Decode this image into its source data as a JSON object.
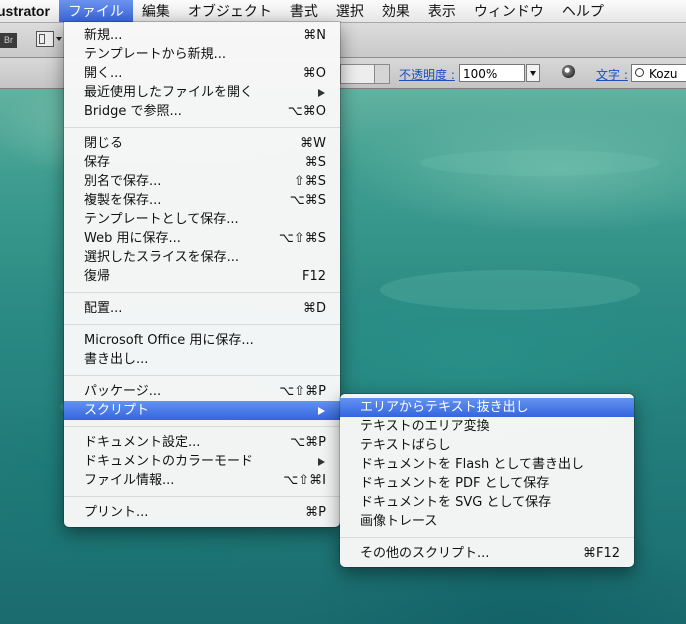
{
  "menubar": {
    "app": "ustrator",
    "items": [
      "ファイル",
      "編集",
      "オブジェクト",
      "書式",
      "選択",
      "効果",
      "表示",
      "ウィンドウ",
      "ヘルプ"
    ]
  },
  "toolbar": {
    "bridge_badge": "Br",
    "opacity_label": "不透明度 :",
    "opacity_value": "100%",
    "character_label": "文字 :",
    "font_value": "Kozu"
  },
  "file_menu": {
    "groups": [
      [
        {
          "label": "新規...",
          "shortcut": "⌘N"
        },
        {
          "label": "テンプレートから新規...",
          "shortcut": ""
        },
        {
          "label": "開く...",
          "shortcut": "⌘O"
        },
        {
          "label": "最近使用したファイルを開く",
          "shortcut": "",
          "submenu": true
        },
        {
          "label": "Bridge で参照...",
          "shortcut": "⌥⌘O"
        }
      ],
      [
        {
          "label": "閉じる",
          "shortcut": "⌘W"
        },
        {
          "label": "保存",
          "shortcut": "⌘S"
        },
        {
          "label": "別名で保存...",
          "shortcut": "⇧⌘S"
        },
        {
          "label": "複製を保存...",
          "shortcut": "⌥⌘S"
        },
        {
          "label": "テンプレートとして保存...",
          "shortcut": ""
        },
        {
          "label": "Web 用に保存...",
          "shortcut": "⌥⇧⌘S"
        },
        {
          "label": "選択したスライスを保存...",
          "shortcut": ""
        },
        {
          "label": "復帰",
          "shortcut": "F12"
        }
      ],
      [
        {
          "label": "配置...",
          "shortcut": "⌘D"
        }
      ],
      [
        {
          "label": "Microsoft Office 用に保存...",
          "shortcut": ""
        },
        {
          "label": "書き出し...",
          "shortcut": ""
        }
      ],
      [
        {
          "label": "パッケージ...",
          "shortcut": "⌥⇧⌘P"
        },
        {
          "label": "スクリプト",
          "shortcut": "",
          "submenu": true,
          "highlighted": true
        }
      ],
      [
        {
          "label": "ドキュメント設定...",
          "shortcut": "⌥⌘P"
        },
        {
          "label": "ドキュメントのカラーモード",
          "shortcut": "",
          "submenu": true
        },
        {
          "label": "ファイル情報...",
          "shortcut": "⌥⇧⌘I"
        }
      ],
      [
        {
          "label": "プリント...",
          "shortcut": "⌘P"
        }
      ]
    ]
  },
  "script_menu": {
    "groups": [
      [
        {
          "label": "エリアからテキスト抜き出し",
          "shortcut": "",
          "highlighted": true
        },
        {
          "label": "テキストのエリア変換",
          "shortcut": ""
        },
        {
          "label": "テキストばらし",
          "shortcut": ""
        },
        {
          "label": "ドキュメントを Flash として書き出し",
          "shortcut": ""
        },
        {
          "label": "ドキュメントを PDF として保存",
          "shortcut": ""
        },
        {
          "label": "ドキュメントを SVG として保存",
          "shortcut": ""
        },
        {
          "label": "画像トレース",
          "shortcut": ""
        }
      ],
      [
        {
          "label": "その他のスクリプト...",
          "shortcut": "⌘F12"
        }
      ]
    ]
  }
}
